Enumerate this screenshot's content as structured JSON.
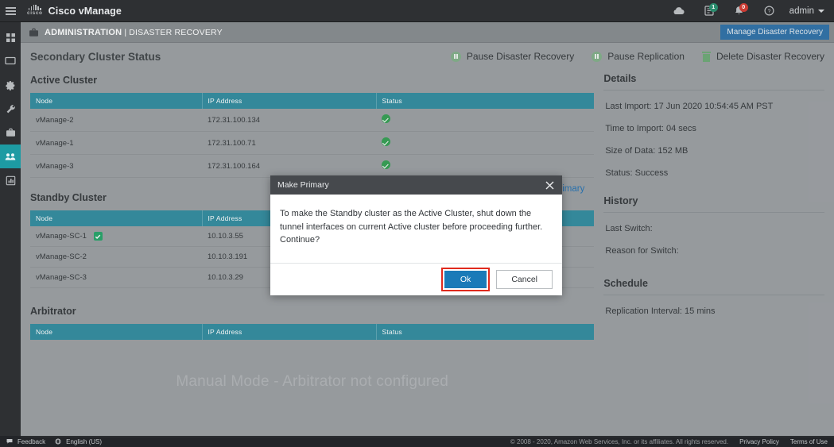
{
  "topbar": {
    "brand": "Cisco vManage",
    "cisco_wordmark": "cisco",
    "menu_icon": "hamburger-icon",
    "icons": [
      {
        "name": "cloud-icon",
        "badge": ""
      },
      {
        "name": "tasks-icon",
        "badge": "1",
        "badge_color": "#2b8c6e"
      },
      {
        "name": "alarm-bell-icon",
        "badge": "0",
        "badge_color": "#cc3b33"
      },
      {
        "name": "help-icon",
        "badge": ""
      }
    ],
    "user": "admin"
  },
  "sidebar": {
    "items": [
      {
        "name": "dashboard-icon",
        "label": "Dashboard",
        "active": false
      },
      {
        "name": "monitor-icon",
        "label": "Monitor",
        "active": false
      },
      {
        "name": "configuration-gear-icon",
        "label": "Configuration",
        "active": false
      },
      {
        "name": "tools-wrench-icon",
        "label": "Tools",
        "active": false
      },
      {
        "name": "maintenance-briefcase-icon",
        "label": "Maintenance",
        "active": false
      },
      {
        "name": "administration-users-icon",
        "label": "Administration",
        "active": true
      },
      {
        "name": "reports-icon",
        "label": "Reports",
        "active": false
      }
    ]
  },
  "breadcrumb": {
    "icon": "briefcase-icon",
    "primary": "ADMINISTRATION",
    "separator": "|",
    "secondary": "DISASTER RECOVERY",
    "manage_button": "Manage Disaster Recovery"
  },
  "page": {
    "title": "Secondary Cluster Status",
    "actions": [
      {
        "label": "Pause Disaster Recovery",
        "icon": "pause-circle-icon"
      },
      {
        "label": "Pause Replication",
        "icon": "pause-circle-icon"
      },
      {
        "label": "Delete Disaster Recovery",
        "icon": "trash-icon"
      }
    ]
  },
  "tables": {
    "columns": [
      "Node",
      "IP Address",
      "Status"
    ],
    "active_cluster": {
      "title": "Active Cluster",
      "rows": [
        {
          "node": "vManage-2",
          "ip": "172.31.100.134",
          "status": "ok"
        },
        {
          "node": "vManage-1",
          "ip": "172.31.100.71",
          "status": "ok"
        },
        {
          "node": "vManage-3",
          "ip": "172.31.100.164",
          "status": "ok"
        }
      ]
    },
    "standby_cluster": {
      "title": "Standby Cluster",
      "make_primary_link": "Make Primary",
      "rows": [
        {
          "node": "vManage-SC-1",
          "ip": "10.10.3.55",
          "status": "",
          "checked": true
        },
        {
          "node": "vManage-SC-2",
          "ip": "10.10.3.191",
          "status": "",
          "checked": false
        },
        {
          "node": "vManage-SC-3",
          "ip": "10.10.3.29",
          "status": "",
          "checked": false
        }
      ]
    },
    "arbitrator": {
      "title": "Arbitrator",
      "empty_message": "Manual Mode - Arbitrator not configured"
    }
  },
  "details": {
    "title": "Details",
    "last_import": "Last Import: 17 Jun 2020 10:54:45 AM PST",
    "time_to_import": "Time to Import: 04 secs",
    "size_of_data": "Size of Data: 152 MB",
    "status": "Status: Success"
  },
  "history": {
    "title": "History",
    "last_switch": "Last Switch:",
    "reason_for_switch": "Reason for Switch:"
  },
  "schedule": {
    "title": "Schedule",
    "replication_interval": "Replication Interval: 15 mins"
  },
  "modal": {
    "title": "Make Primary",
    "close_icon": "close-x-icon",
    "message": "To make the Standby cluster as the Active Cluster, shut down the tunnel interfaces on current Active cluster before proceeding further. Continue?",
    "ok_label": "Ok",
    "cancel_label": "Cancel",
    "highlight_color": "#e02a1e"
  },
  "footer": {
    "feedback": "Feedback",
    "language": "English (US)",
    "copyright": "© 2008 - 2020, Amazon Web Services, Inc. or its affiliates. All rights reserved.",
    "privacy": "Privacy Policy",
    "terms": "Terms of Use"
  }
}
